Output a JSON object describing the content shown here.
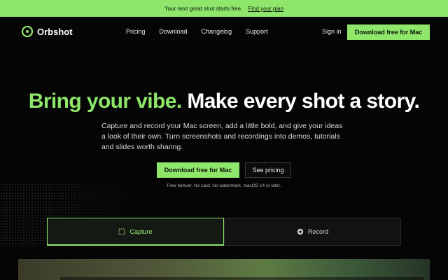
{
  "banner": {
    "text": "Your next great shot starts free.",
    "link": "Find your plan"
  },
  "brand": {
    "name": "Orbshot"
  },
  "nav": {
    "links": [
      "Pricing",
      "Download",
      "Changelog",
      "Support"
    ],
    "signin": "Sign in",
    "cta": "Download free for Mac"
  },
  "hero": {
    "headline_green": "Bring your vibe.",
    "headline_white": "Make every shot a story.",
    "subtitle": "Capture and record your Mac screen, add a little bold, and give your ideas a look of their own. Turn screenshots and recordings into demos, tutorials and slides worth sharing.",
    "primary_cta": "Download free for Mac",
    "secondary_cta": "See pricing",
    "fine_print": "Free forever. No card. No watermark. macOS 14 or later."
  },
  "tabs": [
    {
      "label": "Capture",
      "icon": "capture-frame-icon",
      "active": true
    },
    {
      "label": "Record",
      "icon": "record-icon",
      "active": false
    }
  ],
  "colors": {
    "accent": "#8ee66b",
    "background": "#050505"
  }
}
